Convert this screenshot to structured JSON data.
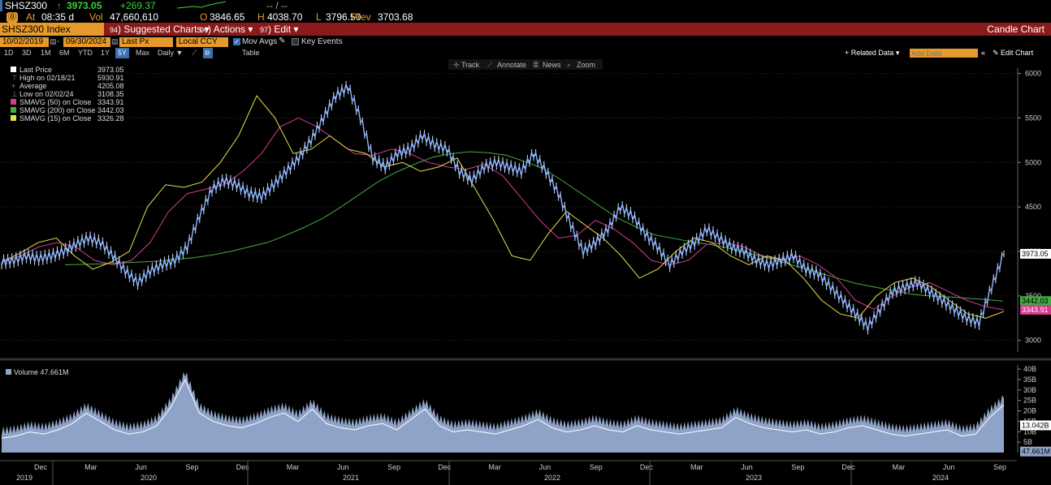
{
  "ticker": {
    "symbol": "SHSZ300",
    "last": "3973.05",
    "change": "+269.37",
    "change_arrow": "↑",
    "quote_mid": "-- / --"
  },
  "quote": {
    "at_label": "At",
    "time": "08:35 d",
    "vol_label": "Vol",
    "vol": "47,660,610",
    "o_label": "O",
    "open": "3846.65",
    "h_label": "H",
    "high": "4038.70",
    "l_label": "L",
    "low": "3796.50",
    "prev_label": "Prev",
    "prev": "3703.68"
  },
  "menubar": {
    "index": "SHSZ300 Index",
    "suggested": "Suggested Charts",
    "suggested_num": "94",
    "actions": "Actions",
    "actions_num": "96",
    "edit": "Edit",
    "edit_num": "97",
    "chart_type": "Candle Chart"
  },
  "controls": {
    "start_date": "10/02/2019",
    "end_date": "09/30/2024",
    "field": "Last Px",
    "currency": "Local CCY",
    "mov_avgs": "Mov Avgs",
    "key_events": "Key Events"
  },
  "timeframes": [
    "1D",
    "3D",
    "1M",
    "6M",
    "YTD",
    "1Y",
    "5Y",
    "Max"
  ],
  "timeframe_selected": "5Y",
  "period": "Daily",
  "table_label": "Table",
  "related_data": "Related Data",
  "add_data_placeholder": "Add Data",
  "edit_chart": "Edit Chart",
  "chart_tools": [
    "Track",
    "Annotate",
    "News",
    "Zoom"
  ],
  "legend": [
    {
      "label": "Last Price",
      "value": "3973.05",
      "color": "#ffffff"
    },
    {
      "label": "High on 02/18/21",
      "value": "5930.91",
      "color": "#888888"
    },
    {
      "label": "Average",
      "value": "4205.08",
      "color": "#888888"
    },
    {
      "label": "Low on 02/02/24",
      "value": "3108.35",
      "color": "#888888"
    },
    {
      "label": "SMAVG (50)  on Close",
      "value": "3343.91",
      "color": "#d63b8f"
    },
    {
      "label": "SMAVG (200)  on Close",
      "value": "3442.03",
      "color": "#3fae3f"
    },
    {
      "label": "SMAVG (15)  on Close",
      "value": "3326.28",
      "color": "#e8e04a"
    }
  ],
  "volume_legend": {
    "label": "Volume",
    "value": "47.661M"
  },
  "chart_data": {
    "type": "line",
    "price_ticks": [
      3000,
      3500,
      4000,
      4500,
      5000,
      5500,
      6000
    ],
    "price_tick_labels": [
      "3000",
      "3500",
      "4000",
      "4500",
      "5000",
      "5500",
      "6000"
    ],
    "ylim": [
      2870,
      6060
    ],
    "volume_ticks": [
      "40B",
      "35B",
      "30B",
      "25B",
      "20B",
      "15B",
      "10B",
      "5B"
    ],
    "volume_tick_values": [
      40,
      35,
      30,
      25,
      20,
      15,
      10,
      5
    ],
    "volume_ylim": [
      0,
      42
    ],
    "month_labels": [
      "Dec",
      "Mar",
      "Jun",
      "Sep",
      "Dec",
      "Mar",
      "Jun",
      "Sep",
      "Dec",
      "Mar",
      "Jun",
      "Sep",
      "Dec",
      "Mar",
      "Jun",
      "Sep",
      "Dec",
      "Mar",
      "Jun",
      "Sep"
    ],
    "year_labels": [
      "2019",
      "2020",
      "2021",
      "2022",
      "2023",
      "2024"
    ],
    "right_labels": [
      {
        "text": "3973.05",
        "value": 3973.05,
        "bg": "#ffffff",
        "fg": "#000000"
      },
      {
        "text": "3442.03",
        "value": 3442.03,
        "bg": "#3fae3f",
        "fg": "#000000"
      },
      {
        "text": "3343.91",
        "value": 3343.91,
        "bg": "#d63b8f",
        "fg": "#ffffff"
      }
    ],
    "volume_right_labels": [
      {
        "text": "13.042B",
        "value": 13.042,
        "bg": "#ffffff",
        "fg": "#000000"
      },
      {
        "text": "47.661M",
        "value": 0.5,
        "bg": "#8fa3c8",
        "fg": "#000000"
      }
    ],
    "series": [
      {
        "name": "Last Price",
        "values": [
          3880,
          3900,
          3950,
          3920,
          3950,
          4000,
          4080,
          4150,
          4100,
          3950,
          3780,
          3650,
          3780,
          3850,
          3900,
          4050,
          4400,
          4700,
          4800,
          4750,
          4650,
          4620,
          4750,
          4900,
          5050,
          5250,
          5500,
          5750,
          5850,
          5500,
          5050,
          4950,
          5100,
          5150,
          5300,
          5200,
          5150,
          4900,
          4800,
          4950,
          5000,
          4950,
          4900,
          5100,
          4900,
          4650,
          4300,
          4000,
          4100,
          4250,
          4500,
          4400,
          4200,
          4050,
          3850,
          4000,
          4100,
          4250,
          4150,
          4050,
          4000,
          3900,
          3850,
          3900,
          3950,
          3800,
          3750,
          3600,
          3450,
          3300,
          3150,
          3350,
          3550,
          3600,
          3650,
          3550,
          3450,
          3350,
          3250,
          3200,
          3600,
          3973
        ]
      },
      {
        "name": "SMAVG (200)",
        "values": [
          3850,
          3855,
          3860,
          3870,
          3880,
          3890,
          3910,
          3930,
          3960,
          4000,
          4050,
          4100,
          4180,
          4270,
          4370,
          4500,
          4640,
          4780,
          4890,
          4980,
          5060,
          5100,
          5120,
          5110,
          5080,
          5010,
          4930,
          4800,
          4660,
          4520,
          4380,
          4280,
          4190,
          4150,
          4110,
          4080,
          4040,
          3990,
          3940,
          3880,
          3820,
          3760,
          3700,
          3640,
          3600,
          3560,
          3520,
          3500,
          3490,
          3475,
          3460,
          3442
        ]
      },
      {
        "name": "SMAVG (50)",
        "values": [
          3880,
          3950,
          4050,
          4100,
          4050,
          3900,
          3850,
          3900,
          4100,
          4450,
          4650,
          4700,
          4750,
          4900,
          5100,
          5400,
          5500,
          5400,
          5250,
          5100,
          5080,
          5150,
          5100,
          5000,
          4950,
          4920,
          4980,
          4850,
          4600,
          4350,
          4150,
          4180,
          4350,
          4250,
          4100,
          3900,
          3850,
          3900,
          4080,
          4100,
          4050,
          3950,
          3900,
          3950,
          3850,
          3700,
          3450,
          3350,
          3500,
          3600,
          3650,
          3550,
          3450,
          3380,
          3344
        ]
      },
      {
        "name": "SMAVG (15)",
        "values": [
          3880,
          3980,
          4100,
          4150,
          3950,
          3800,
          3880,
          4000,
          4500,
          4750,
          4720,
          4780,
          5000,
          5300,
          5750,
          5500,
          5100,
          5150,
          5300,
          5150,
          5100,
          4950,
          5000,
          4900,
          4950,
          5050,
          4700,
          4350,
          3950,
          3900,
          4200,
          4450,
          4300,
          4150,
          3950,
          3700,
          3800,
          4000,
          4150,
          4100,
          3950,
          3850,
          3950,
          3900,
          3700,
          3450,
          3300,
          3250,
          3500,
          3650,
          3700,
          3600,
          3450,
          3300,
          3250,
          3326
        ]
      },
      {
        "name": "Volume",
        "values": [
          10,
          11,
          13,
          12,
          14,
          17,
          22,
          18,
          14,
          12,
          13,
          16,
          25,
          38,
          22,
          18,
          16,
          15,
          17,
          20,
          22,
          18,
          24,
          17,
          15,
          14,
          16,
          17,
          14,
          19,
          24,
          16,
          13,
          14,
          13,
          12,
          14,
          16,
          19,
          15,
          13,
          14,
          16,
          14,
          13,
          16,
          14,
          13,
          12,
          13,
          14,
          15,
          20,
          17,
          15,
          14,
          13,
          14,
          12,
          13,
          15,
          16,
          14,
          12,
          11,
          12,
          13,
          14,
          11,
          12,
          20,
          26
        ]
      }
    ]
  }
}
